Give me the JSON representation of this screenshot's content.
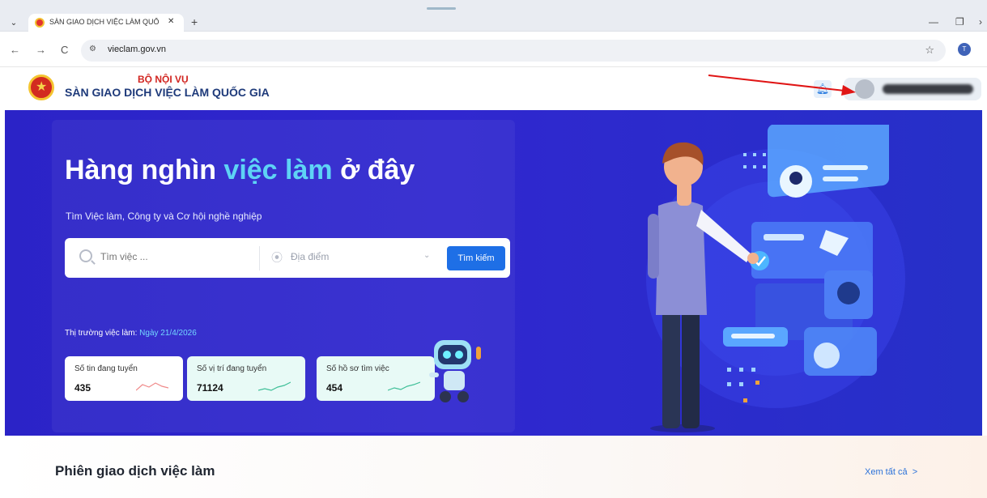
{
  "browser": {
    "tab_title": "SÀN GIAO DỊCH VIỆC LÀM QUỐ",
    "tab_close": "✕",
    "new_tab": "+",
    "tab_menu": "⌄",
    "url": "vieclam.gov.vn",
    "site_info_icon": "tune-icon",
    "bookmark": "☆",
    "profile_initial": "T",
    "back": "←",
    "forward": "→",
    "reload": "C",
    "minimize": "—",
    "maximize": "❐",
    "overflow": "›"
  },
  "header": {
    "ministry": "BỘ NỘI VỤ",
    "site_name": "SÀN GIAO DỊCH VIỆC LÀM QUỐC GIA",
    "bell_icon": "bell-icon"
  },
  "hero": {
    "headline_part1": "Hàng nghìn ",
    "headline_highlight": "việc làm",
    "headline_part2": " ở đây",
    "subtitle": "Tìm Việc làm, Công ty và Cơ hội nghề nghiệp",
    "search_placeholder": "Tìm việc ...",
    "location_placeholder": "Địa điểm",
    "search_button": "Tìm kiếm",
    "market_label": "Thị trường việc làm: ",
    "market_date": "Ngày 21/4/2026",
    "stats": [
      {
        "label": "Số tin đang tuyển",
        "value": "435",
        "bg": "#ffffff"
      },
      {
        "label": "Số vị trí đang tuyển",
        "value": "71124",
        "bg": "#e8faf6"
      },
      {
        "label": "Số hồ sơ tìm việc",
        "value": "454",
        "bg": "#e8faf6"
      }
    ]
  },
  "section": {
    "title": "Phiên giao dịch việc làm",
    "view_all": "Xem tất cả",
    "view_all_arrow": ">"
  },
  "colors": {
    "hero_bg": "#2b23c7",
    "highlight": "#5ed3f5",
    "primary_button": "#1e6fe6",
    "ministry_red": "#d1241f",
    "annotation_arrow": "#e01515"
  }
}
